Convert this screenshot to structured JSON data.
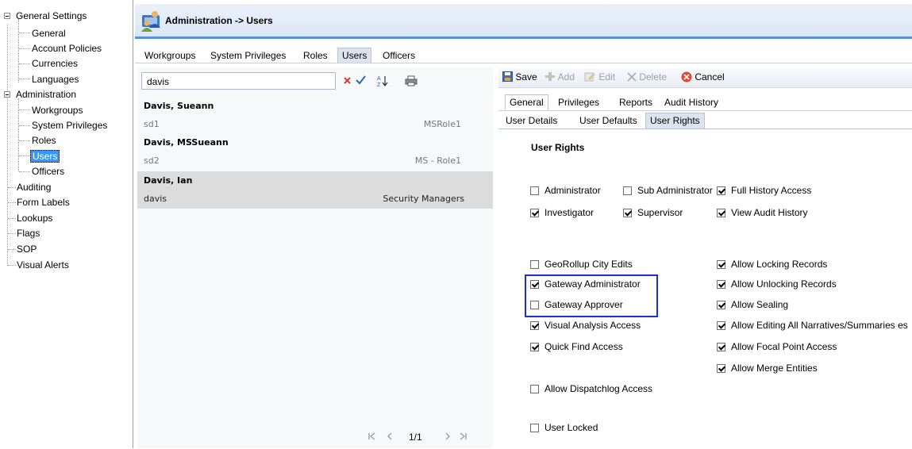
{
  "tree": {
    "items": [
      {
        "label": "General Settings",
        "group": true
      },
      {
        "label": "General"
      },
      {
        "label": "Account Policies"
      },
      {
        "label": "Currencies"
      },
      {
        "label": "Languages"
      },
      {
        "label": "Administration",
        "group": true
      },
      {
        "label": "Workgroups"
      },
      {
        "label": "System Privileges"
      },
      {
        "label": "Roles"
      },
      {
        "label": "Users",
        "selected": true
      },
      {
        "label": "Officers"
      },
      {
        "label": "Auditing"
      },
      {
        "label": "Form Labels"
      },
      {
        "label": "Lookups"
      },
      {
        "label": "Flags"
      },
      {
        "label": "SOP"
      },
      {
        "label": "Visual Alerts"
      }
    ]
  },
  "header": {
    "title": "Administration -> Users"
  },
  "main_tabs": [
    "Workgroups",
    "System Privileges",
    "Roles",
    "Users",
    "Officers"
  ],
  "search": {
    "value": "davis"
  },
  "records": [
    {
      "name": "Davis, Sueann",
      "id": "sd1",
      "role": "MSRole1"
    },
    {
      "name": "Davis, MSSueann",
      "id": "sd2",
      "role": "MS - Role1"
    },
    {
      "name": "Davis, Ian",
      "id": "davis",
      "role": "Security Managers"
    }
  ],
  "pager": {
    "page": "1/1"
  },
  "toolbar": {
    "save": "Save",
    "add": "Add",
    "edit": "Edit",
    "delete": "Delete",
    "cancel": "Cancel"
  },
  "detail_tabs": [
    "General",
    "Privileges",
    "Reports",
    "Audit History"
  ],
  "user_tabs": [
    "User Details",
    "User Defaults",
    "User Rights"
  ],
  "rights": {
    "heading": "User Rights",
    "items": [
      {
        "label": "Administrator",
        "checked": false
      },
      {
        "label": "Sub Administrator",
        "checked": false
      },
      {
        "label": "Full History Access",
        "checked": true
      },
      {
        "label": "Investigator",
        "checked": true
      },
      {
        "label": "Supervisor",
        "checked": true
      },
      {
        "label": "View Audit History",
        "checked": true
      },
      {
        "label": "GeoRollup City Edits",
        "checked": false
      },
      {
        "label": "Allow Locking Records",
        "checked": true
      },
      {
        "label": "Gateway Administrator",
        "checked": true
      },
      {
        "label": "Allow Unlocking Records",
        "checked": true
      },
      {
        "label": "Gateway Approver",
        "checked": false
      },
      {
        "label": "Allow Sealing",
        "checked": true
      },
      {
        "label": "Visual Analysis Access",
        "checked": true
      },
      {
        "label": "Allow Editing All Narratives/Summaries es",
        "checked": true
      },
      {
        "label": "Quick Find Access",
        "checked": true
      },
      {
        "label": "Allow Focal Point Access",
        "checked": true
      },
      {
        "label": "Allow Merge Entities",
        "checked": true
      },
      {
        "label": "Allow Dispatchlog Access",
        "checked": false
      },
      {
        "label": "User Locked",
        "checked": false
      }
    ]
  },
  "colors": {
    "accent": "#5b8fd6",
    "selection": "#3399ff",
    "highlight_box": "#1a2fd6"
  }
}
